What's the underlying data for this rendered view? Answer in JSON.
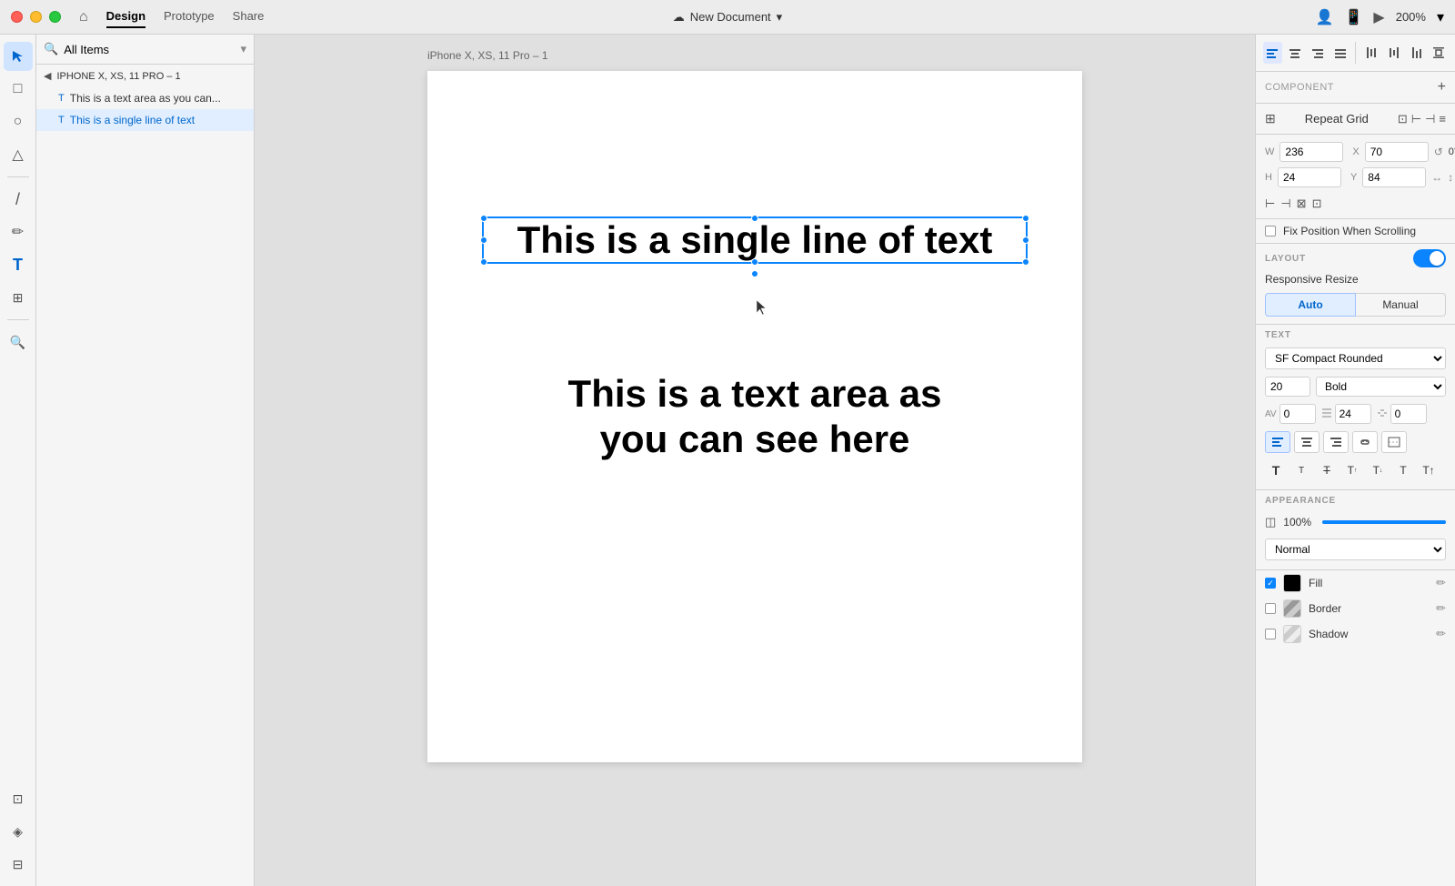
{
  "titlebar": {
    "traffic_lights": [
      "red",
      "yellow",
      "green"
    ],
    "home_label": "⌂",
    "nav_tabs": [
      {
        "label": "Design",
        "active": true
      },
      {
        "label": "Prototype",
        "active": false
      },
      {
        "label": "Share",
        "active": false
      }
    ],
    "doc_title": "New Document",
    "dropdown_arrow": "▾",
    "right_icons": [
      "👤",
      "📱",
      "▶"
    ],
    "zoom_level": "200%"
  },
  "left_toolbar": {
    "tools": [
      {
        "name": "select",
        "icon": "↖",
        "active": true
      },
      {
        "name": "rectangle",
        "icon": "□"
      },
      {
        "name": "ellipse",
        "icon": "○"
      },
      {
        "name": "triangle",
        "icon": "△"
      },
      {
        "name": "line",
        "icon": "/"
      },
      {
        "name": "pen",
        "icon": "✏"
      },
      {
        "name": "text",
        "icon": "T"
      },
      {
        "name": "component",
        "icon": "⊞"
      },
      {
        "name": "zoom",
        "icon": "🔍"
      }
    ],
    "bottom_tools": [
      {
        "name": "artboard",
        "icon": "⊡"
      },
      {
        "name": "layers",
        "icon": "◈"
      },
      {
        "name": "assets",
        "icon": "⊟"
      }
    ]
  },
  "layers_panel": {
    "search_placeholder": "All Items",
    "group_header": "IPHONE X, XS, 11 PRO – 1",
    "items": [
      {
        "label": "This is a text area as you can...",
        "type": "text",
        "selected": false
      },
      {
        "label": "This is a single line of text",
        "type": "text",
        "selected": true
      }
    ]
  },
  "canvas": {
    "artboard_label": "iPhone X, XS, 11 Pro – 1",
    "selected_text": "This is a single line of text",
    "static_text_line1": "This is a text area as",
    "static_text_line2": "you can see here"
  },
  "right_panel": {
    "component_label": "COMPONENT",
    "add_btn": "+",
    "repeat_grid_label": "Repeat Grid",
    "align_icons": [
      "⊞",
      "⊟",
      "⊠",
      "≡",
      "⊡",
      "⊢",
      "⊣",
      "≡"
    ],
    "dimensions": {
      "w_label": "W",
      "w_value": "236",
      "x_label": "X",
      "x_value": "70",
      "h_label": "H",
      "h_value": "24",
      "y_label": "Y",
      "y_value": "84",
      "rotation_value": "0°"
    },
    "fix_position_label": "Fix Position When Scrolling",
    "layout": {
      "label": "LAYOUT",
      "responsive_resize": "Responsive Resize",
      "auto_label": "Auto",
      "manual_label": "Manual"
    },
    "text_section": {
      "label": "TEXT",
      "font_family": "SF Compact Rounded",
      "font_size": "20",
      "font_weight": "Bold",
      "av_label": "AV",
      "av_value": "0",
      "line_height_label": "≡",
      "line_height_value": "24",
      "letter_spacing_label": "≡",
      "letter_spacing_value": "0",
      "align_buttons": [
        "left",
        "center",
        "right",
        "link",
        "fill"
      ],
      "style_buttons": [
        "T",
        "T",
        "T",
        "T↑",
        "T↓",
        "T",
        "T↑"
      ]
    },
    "appearance": {
      "label": "APPEARANCE",
      "opacity_value": "100%",
      "blend_mode": "Normal",
      "fill_label": "Fill",
      "fill_color": "#000000",
      "fill_checked": true,
      "border_label": "Border",
      "border_checked": false,
      "shadow_label": "Shadow",
      "shadow_checked": false
    }
  }
}
